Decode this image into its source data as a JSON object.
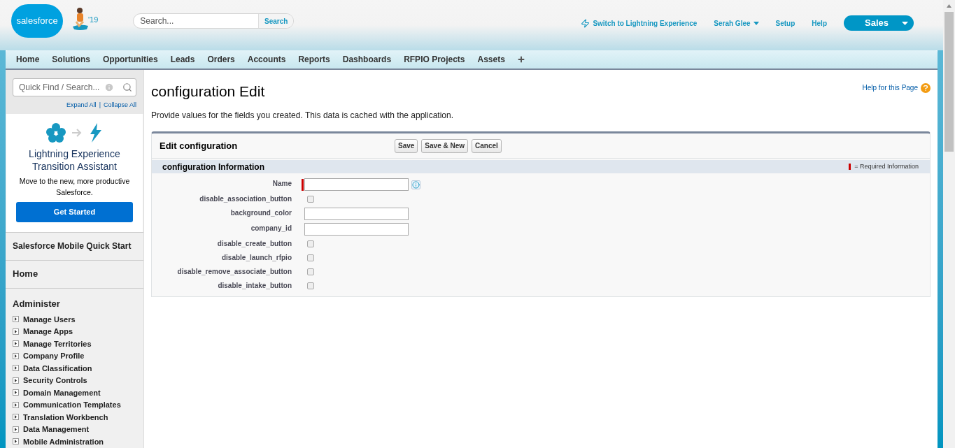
{
  "header": {
    "logo": "salesforce",
    "mascot_year": "'19",
    "search": {
      "placeholder": "Search...",
      "button": "Search"
    },
    "links": [
      "Switch to Lightning Experience",
      "Serah Glee",
      "Setup",
      "Help"
    ],
    "app_menu": "Sales"
  },
  "tabs": [
    {
      "label": "Home",
      "selected": false
    },
    {
      "label": "Solutions",
      "selected": false
    },
    {
      "label": "Opportunities",
      "selected": false
    },
    {
      "label": "Leads",
      "selected": false
    },
    {
      "label": "Orders",
      "selected": false
    },
    {
      "label": "Accounts",
      "selected": false
    },
    {
      "label": "Reports",
      "selected": false
    },
    {
      "label": "Dashboards",
      "selected": false
    },
    {
      "label": "RFPIO Projects",
      "selected": false
    },
    {
      "label": "Assets",
      "selected": false
    }
  ],
  "sidebar": {
    "quick_find": {
      "placeholder": "Quick Find / Search..."
    },
    "expand_all": "Expand All",
    "separator": "|",
    "collapse_all": "Collapse All",
    "promo": {
      "title": "Lightning Experience Transition Assistant",
      "text": "Move to the new, more productive Salesforce.",
      "button": "Get Started"
    },
    "sections": [
      "Salesforce Mobile Quick Start",
      "Home"
    ],
    "group": {
      "title": "Administer",
      "items": [
        {
          "label": "Manage Users",
          "expanded": false
        },
        {
          "label": "Manage Apps",
          "expanded": false
        },
        {
          "label": "Manage Territories",
          "expanded": false
        },
        {
          "label": "Company Profile",
          "expanded": false
        },
        {
          "label": "Data Classification",
          "expanded": false
        },
        {
          "label": "Security Controls",
          "expanded": false
        },
        {
          "label": "Domain Management",
          "expanded": false
        },
        {
          "label": "Communication Templates",
          "expanded": false
        },
        {
          "label": "Translation Workbench",
          "expanded": false
        },
        {
          "label": "Data Management",
          "expanded": false
        },
        {
          "label": "Mobile Administration",
          "expanded": false
        }
      ]
    }
  },
  "main": {
    "title": "configuration Edit",
    "help": "Help for this Page",
    "description": "Provide values for the fields you created. This data is cached with the application.",
    "form": {
      "title": "Edit configuration",
      "buttons": [
        "Save",
        "Save & New",
        "Cancel"
      ],
      "section": "configuration Information",
      "required_legend": "= Required Information",
      "fields": [
        {
          "label": "Name",
          "kind": "text",
          "required": true
        },
        {
          "label": "disable_association_button",
          "kind": "checkbox",
          "checked": false
        },
        {
          "label": "background_color",
          "kind": "text",
          "required": false
        },
        {
          "label": "company_id",
          "kind": "text",
          "required": false
        },
        {
          "label": "disable_create_button",
          "kind": "checkbox",
          "checked": false
        },
        {
          "label": "disable_launch_rfpio",
          "kind": "checkbox",
          "checked": false
        },
        {
          "label": "disable_remove_associate_button",
          "kind": "checkbox",
          "checked": false
        },
        {
          "label": "disable_intake_button",
          "kind": "checkbox",
          "checked": false
        }
      ]
    }
  }
}
